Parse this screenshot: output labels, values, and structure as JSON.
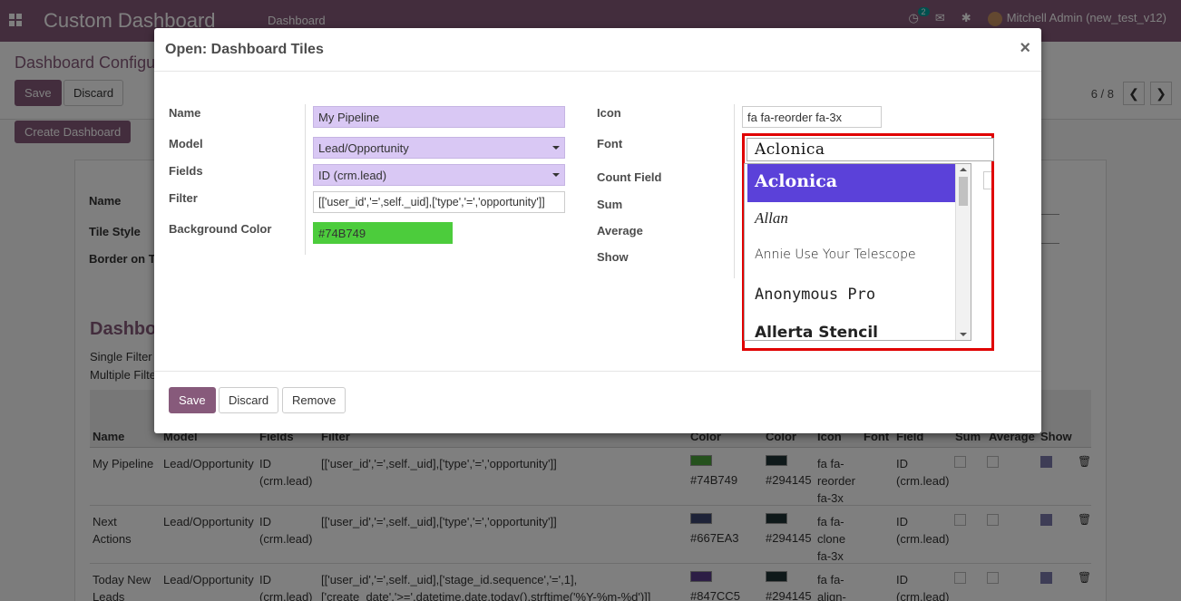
{
  "navbar": {
    "app_title": "Custom Dashboard",
    "menu_item": "Dashboard",
    "activity_count": "2",
    "user": "Mitchell Admin (new_test_v12)"
  },
  "background": {
    "breadcrumb": "Dashboard Configu",
    "save": "Save",
    "discard": "Discard",
    "pager": "6 / 8",
    "create_dashboard": "Create Dashboard",
    "labels": {
      "name": "Name",
      "tile_style": "Tile Style",
      "border": "Border on T"
    },
    "section_title": "Dashbo",
    "single_filter": "Single Filter",
    "multiple_filter": "Multiple Filte",
    "columns": [
      "Name",
      "Model",
      "Fields",
      "Filter",
      "Color",
      "Color",
      "Icon",
      "Font",
      "Field",
      "Sum",
      "Average",
      "Show"
    ],
    "rows": [
      {
        "name": "My Pipeline",
        "model": "Lead/Opportunity",
        "fields": "ID (crm.lead)",
        "filter": "[['user_id','=',self._uid],['type','=','opportunity']]",
        "color1": "#74B749",
        "color2": "#294145",
        "icon": "fa fa-reorder fa-3x",
        "field": "ID (crm.lead)",
        "swatch1": "#4aa33a",
        "swatch2": "#1e3234"
      },
      {
        "name": "Next Actions",
        "model": "Lead/Opportunity",
        "fields": "ID (crm.lead)",
        "filter": "[['user_id','=',self._uid],['type','=','opportunity']]",
        "color1": "#667EA3",
        "color2": "#294145",
        "icon": "fa fa-clone fa-3x",
        "field": "ID (crm.lead)",
        "swatch1": "#3c4670",
        "swatch2": "#1e3234"
      },
      {
        "name": "Today New Leads",
        "model": "Lead/Opportunity",
        "fields": "ID (crm.lead)",
        "filter": "[['user_id','=',self._uid],['stage_id.sequence','=',1], ['create_date','>=',datetime.date.today().strftime('%Y-%m-%d')]]",
        "color1": "#847CC5",
        "color2": "#294145",
        "icon": "fa fa-align-",
        "field": "ID (crm.lead)",
        "swatch1": "#5b3c8a",
        "swatch2": "#1e3234"
      }
    ]
  },
  "modal": {
    "title": "Open: Dashboard Tiles",
    "close": "×",
    "labels": {
      "name": "Name",
      "model": "Model",
      "fields": "Fields",
      "filter": "Filter",
      "background_color": "Background Color",
      "icon": "Icon",
      "font": "Font",
      "count_field": "Count Field",
      "sum": "Sum",
      "average": "Average",
      "show": "Show"
    },
    "values": {
      "name": "My Pipeline",
      "model": "Lead/Opportunity",
      "fields": "ID (crm.lead)",
      "filter": "[['user_id','=',self._uid],['type','=','opportunity']]",
      "background_color": "#74B749",
      "icon": "fa fa-reorder fa-3x",
      "font": "Aclonica"
    },
    "colors": {
      "background_color_swatch": "#4ccc3c"
    },
    "font_options": [
      "Aclonica",
      "Allan",
      "Annie Use Your Telescope",
      "Anonymous Pro",
      "Allerta Stencil"
    ],
    "footer": {
      "save": "Save",
      "discard": "Discard",
      "remove": "Remove"
    }
  }
}
